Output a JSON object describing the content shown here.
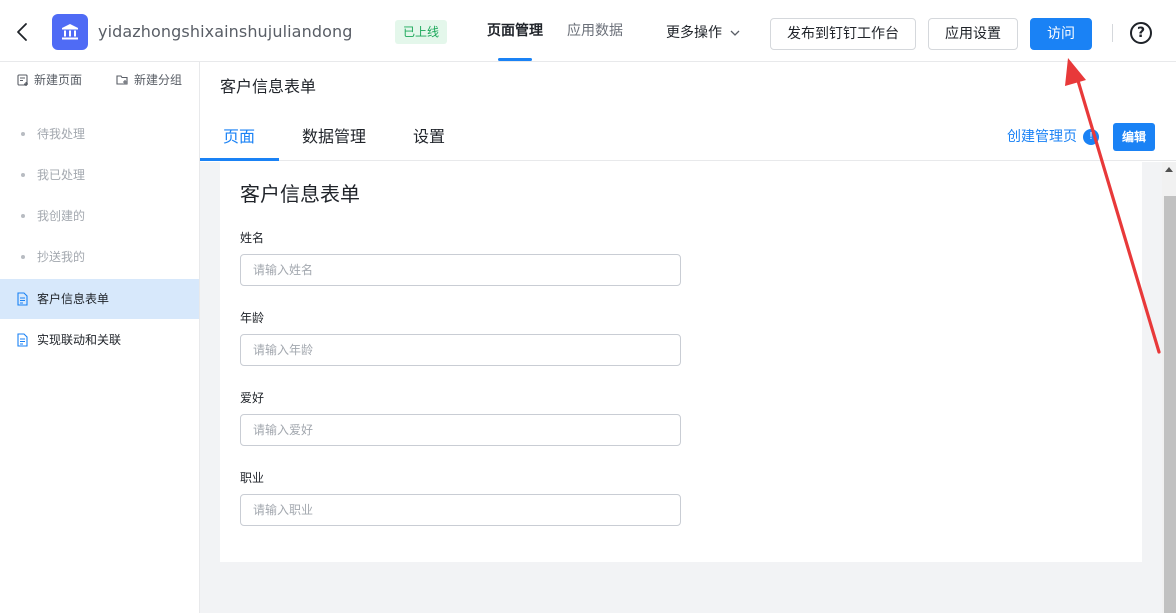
{
  "header": {
    "app_name": "yidazhongshixainshujuliandong",
    "status": "已上线",
    "nav_tabs": [
      {
        "label": "页面管理",
        "active": true
      },
      {
        "label": "应用数据",
        "active": false
      }
    ],
    "more_ops": "更多操作",
    "publish_button": "发布到钉钉工作台",
    "settings_button": "应用设置",
    "visit_button": "访问",
    "help_icon_glyph": "?",
    "icons": {
      "back": "chevron-left-icon",
      "app": "bank-icon",
      "more": "chevron-down-icon",
      "help": "question-circle-icon"
    }
  },
  "sidebar": {
    "new_page": "新建页面",
    "new_group": "新建分组",
    "items": [
      {
        "label": "待我处理",
        "type": "system"
      },
      {
        "label": "我已处理",
        "type": "system"
      },
      {
        "label": "我创建的",
        "type": "system"
      },
      {
        "label": "抄送我的",
        "type": "system"
      },
      {
        "label": "客户信息表单",
        "type": "page",
        "selected": true
      },
      {
        "label": "实现联动和关联",
        "type": "page",
        "selected": false
      }
    ]
  },
  "content": {
    "title": "客户信息表单",
    "tabs": [
      {
        "label": "页面",
        "active": true
      },
      {
        "label": "数据管理",
        "active": false
      },
      {
        "label": "设置",
        "active": false
      }
    ],
    "create_admin_page": "创建管理页",
    "info_badge": "!",
    "edit_button": "编辑"
  },
  "form": {
    "title": "客户信息表单",
    "fields": [
      {
        "label": "姓名",
        "placeholder": "请输入姓名",
        "value": ""
      },
      {
        "label": "年龄",
        "placeholder": "请输入年龄",
        "value": ""
      },
      {
        "label": "爱好",
        "placeholder": "请输入爱好",
        "value": ""
      },
      {
        "label": "职业",
        "placeholder": "请输入职业",
        "value": ""
      }
    ]
  },
  "colors": {
    "accent": "#1a82f5",
    "status_green": "#1ca85a",
    "status_bg": "#e4f7eb",
    "selected_bg": "#d7e8fb",
    "annotation_red": "#e8393a",
    "app_icon_bg": "#4f6bf5"
  }
}
